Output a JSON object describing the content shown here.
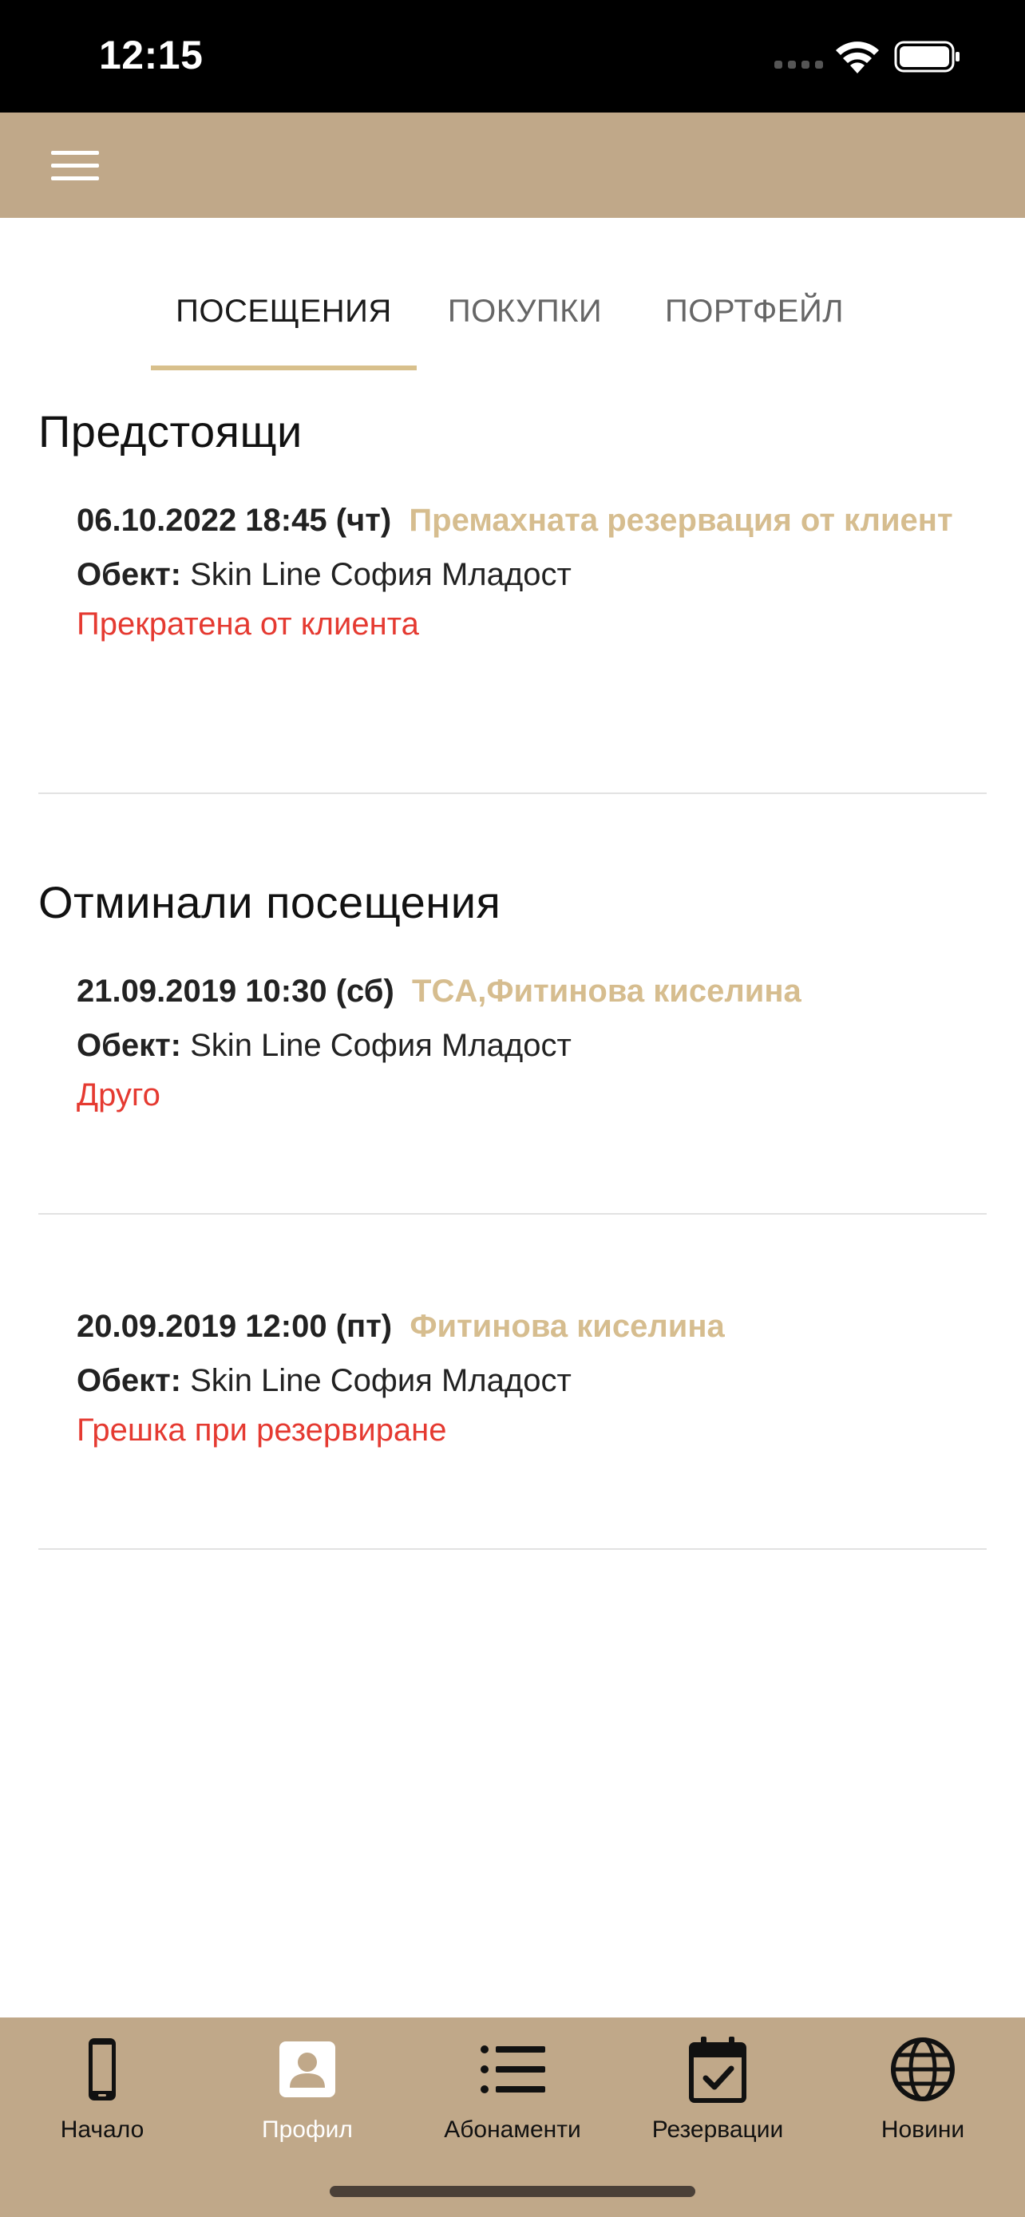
{
  "status_bar": {
    "time": "12:15"
  },
  "tabs": [
    {
      "label": "ПОСЕЩЕНИЯ",
      "active": true
    },
    {
      "label": "ПОКУПКИ",
      "active": false
    },
    {
      "label": "ПОРТФЕЙЛ",
      "active": false
    }
  ],
  "upcoming": {
    "title": "Предстоящи",
    "visits": [
      {
        "date": "06.10.2022 18:45 (чт)",
        "service": "Премахната резервация от клиент",
        "object_label": "Обект:",
        "object_value": "Skin Line София Младост",
        "status": "Прекратена от клиента"
      }
    ]
  },
  "past": {
    "title": "Отминали посещения",
    "visits": [
      {
        "date": "21.09.2019 10:30 (сб)",
        "service": "TCA,Фитинова киселина",
        "object_label": "Обект:",
        "object_value": "Skin Line София Младост",
        "status": "Друго"
      },
      {
        "date": "20.09.2019 12:00 (пт)",
        "service": "Фитинова киселина",
        "object_label": "Обект:",
        "object_value": "Skin Line София Младост",
        "status": "Грешка при резервиране"
      }
    ]
  },
  "tabbar": [
    {
      "label": "Начало",
      "icon": "phone-icon",
      "active": false
    },
    {
      "label": "Профил",
      "icon": "profile-icon",
      "active": true
    },
    {
      "label": "Абонаменти",
      "icon": "list-icon",
      "active": false
    },
    {
      "label": "Резервации",
      "icon": "calendar-check-icon",
      "active": false
    },
    {
      "label": "Новини",
      "icon": "globe-icon",
      "active": false
    }
  ],
  "colors": {
    "nav": "#c0a889",
    "accent": "#d6bd8f",
    "status_red": "#e53a31",
    "tab_indicator": "#d8c08c"
  }
}
